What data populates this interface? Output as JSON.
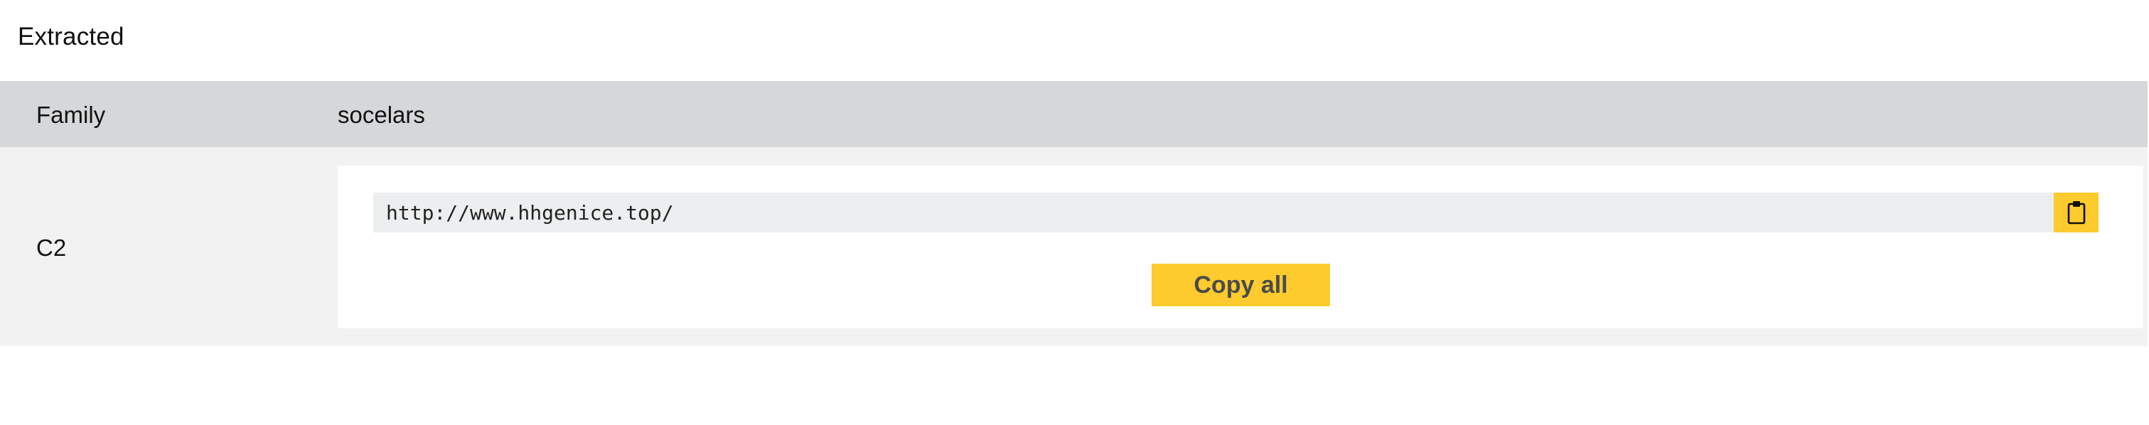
{
  "section": {
    "title": "Extracted"
  },
  "family": {
    "label": "Family",
    "value": "socelars"
  },
  "c2": {
    "label": "C2",
    "url": "http://www.hhgenice.top/",
    "copy_icon": "clipboard-icon",
    "copy_all_label": "Copy all"
  },
  "colors": {
    "accent": "#fdcb2e",
    "header_row_bg": "#d6d7d9",
    "row_bg": "#f2f2f2",
    "field_bg": "#eceeef"
  }
}
